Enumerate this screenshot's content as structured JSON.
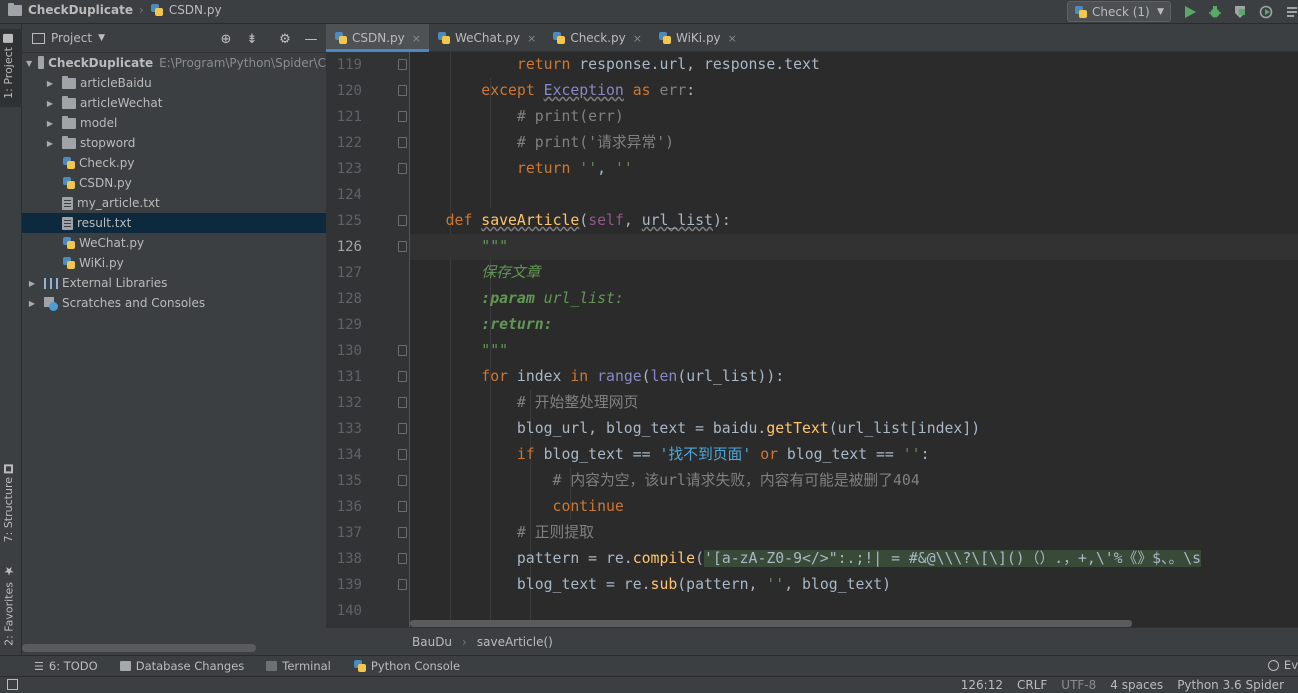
{
  "topbar": {
    "project": "CheckDuplicate",
    "file": "CSDN.py",
    "run_config": "Check (1)"
  },
  "sidestrip": {
    "project_tab": "1: Project",
    "structure_tab": "7: Structure",
    "favorites_tab": "2: Favorites"
  },
  "project_panel": {
    "title": "Project",
    "root": {
      "name": "CheckDuplicate",
      "path": "E:\\Program\\Python\\Spider\\C"
    },
    "items": [
      {
        "label": "articleBaidu",
        "type": "folder"
      },
      {
        "label": "articleWechat",
        "type": "folder"
      },
      {
        "label": "model",
        "type": "folder"
      },
      {
        "label": "stopword",
        "type": "folder"
      },
      {
        "label": "Check.py",
        "type": "py"
      },
      {
        "label": "CSDN.py",
        "type": "py"
      },
      {
        "label": "my_article.txt",
        "type": "txt"
      },
      {
        "label": "result.txt",
        "type": "txt",
        "selected": true
      },
      {
        "label": "WeChat.py",
        "type": "py"
      },
      {
        "label": "WiKi.py",
        "type": "py"
      }
    ],
    "external": "External Libraries",
    "scratches": "Scratches and Consoles"
  },
  "tabs": [
    {
      "label": "CSDN.py",
      "active": true
    },
    {
      "label": "WeChat.py",
      "active": false
    },
    {
      "label": "Check.py",
      "active": false
    },
    {
      "label": "WiKi.py",
      "active": false
    }
  ],
  "editor": {
    "line_numbers": [
      "119",
      "120",
      "121",
      "122",
      "123",
      "124",
      "125",
      "126",
      "127",
      "128",
      "129",
      "130",
      "131",
      "132",
      "133",
      "134",
      "135",
      "136",
      "137",
      "138",
      "139",
      "140"
    ],
    "current_line": "126",
    "doc_title": "保存文章",
    "doc_param_tag": ":param",
    "doc_param_name": "url_list:",
    "doc_return_tag": ":return:",
    "comment_print_err": "# print(err)",
    "comment_print_msg": "# print('请求异常')",
    "comment_start": "# 开始整处理网页",
    "comment_empty": "# 内容为空，该url请求失败，内容有可能是被删了404",
    "comment_regex": "# 正则提取",
    "str_not_found": "'找不到页面'",
    "regex_text": "'[a-zA-Z0-9</>\":.;!| = #&@\\\\\\?\\[\\]()（）.，+,\\'%《》$、。\\s"
  },
  "breadcrumb": {
    "class_name": "BauDu",
    "method_name": "saveArticle()"
  },
  "toolwindows": {
    "todo": "6: TODO",
    "db": "Database Changes",
    "terminal": "Terminal",
    "console": "Python Console",
    "event": "Ev"
  },
  "status": {
    "position": "126:12",
    "line_sep": "CRLF",
    "encoding": "UTF-8",
    "indent": "4 spaces",
    "interpreter": "Python 3.6 Spider"
  }
}
